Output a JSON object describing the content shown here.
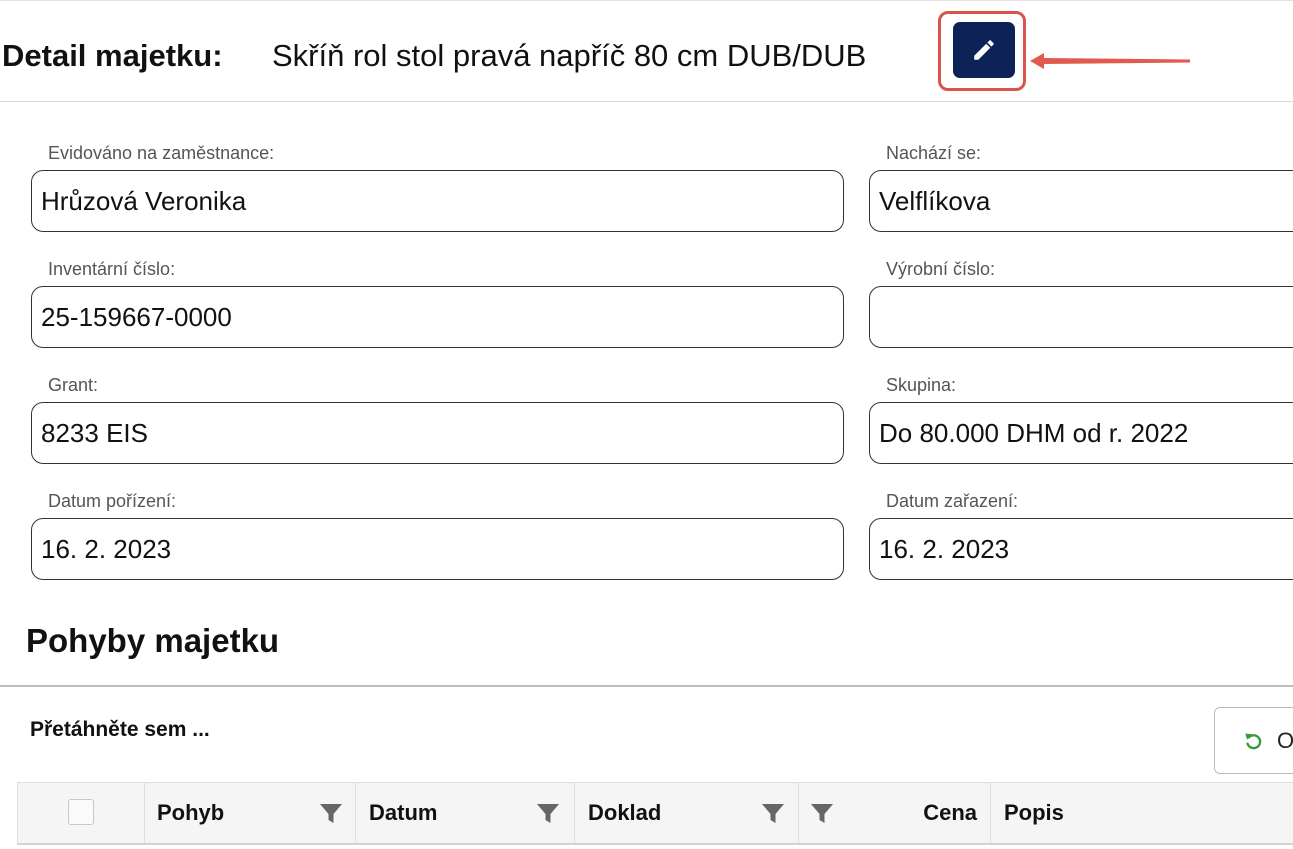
{
  "header": {
    "title_label": "Detail majetku:",
    "title_value": "Skříň rol stol pravá napříč 80 cm DUB/DUB",
    "edit_icon": "pencil-icon",
    "edit_color": "#0d2358",
    "highlight_color": "#d9534f"
  },
  "fields": {
    "employee": {
      "label": "Evidováno na zaměstnance:",
      "value": "Hrůzová Veronika"
    },
    "location": {
      "label": "Nachází se:",
      "value": "Velflíkova"
    },
    "inventory_number": {
      "label": "Inventární číslo:",
      "value": "25-159667-0000"
    },
    "serial_number": {
      "label": "Výrobní číslo:",
      "value": ""
    },
    "grant": {
      "label": "Grant:",
      "value": "8233 EIS"
    },
    "group": {
      "label": "Skupina:",
      "value": "Do 80.000 DHM od r. 2022"
    },
    "purchase_date": {
      "label": "Datum pořízení:",
      "value": "16. 2. 2023"
    },
    "classification_date": {
      "label": "Datum zařazení:",
      "value": "16. 2. 2023"
    }
  },
  "movements": {
    "title": "Pohyby majetku",
    "group_panel": "Přetáhněte sem ...",
    "reset_label": "O",
    "reset_icon": "undo-icon",
    "columns": [
      "Pohyb",
      "Datum",
      "Doklad",
      "",
      "Cena",
      "Popis"
    ]
  }
}
